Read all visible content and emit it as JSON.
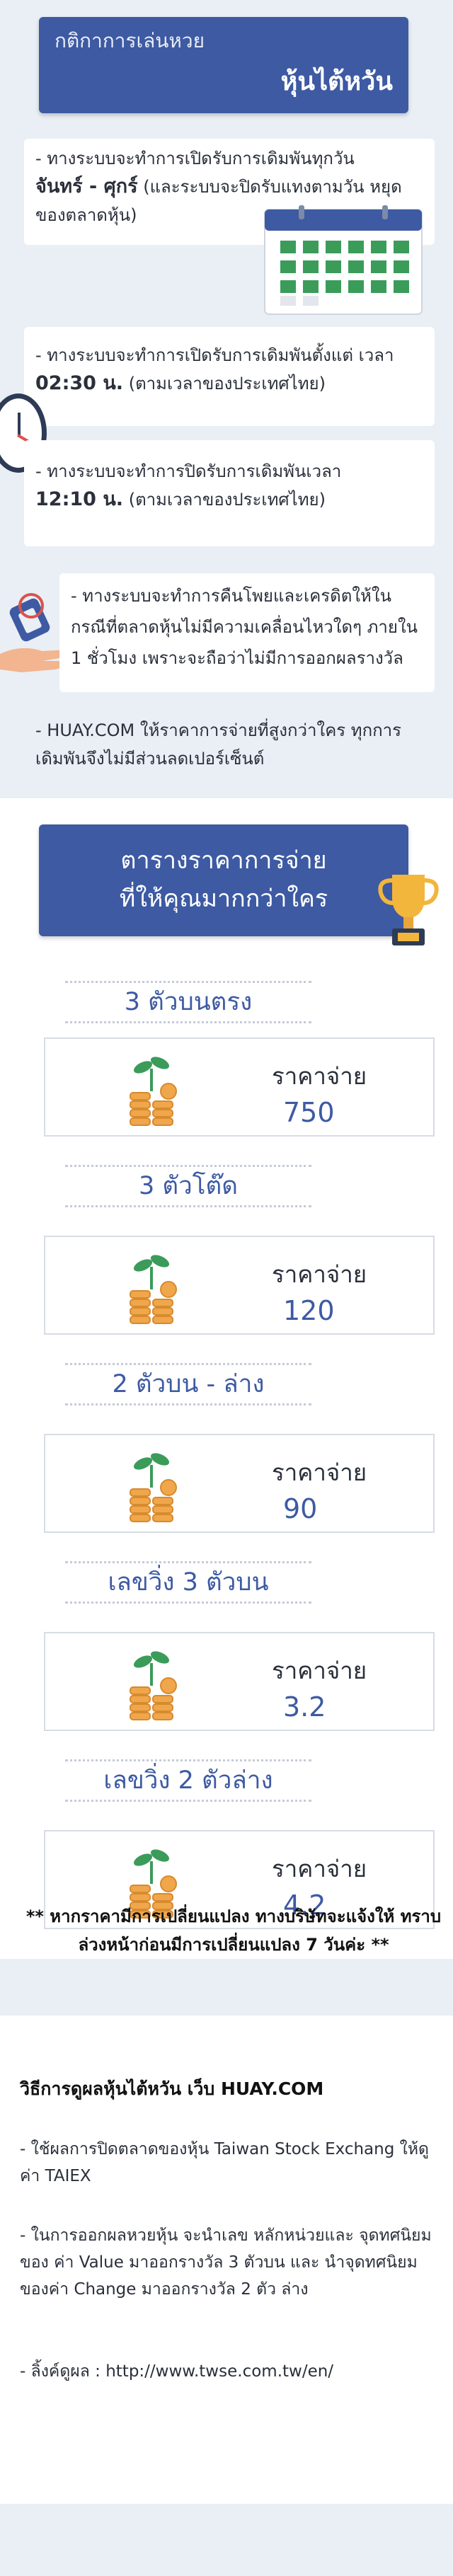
{
  "hero": {
    "subtitle": "กติกาการเล่นหวย",
    "title": "หุ้นไต้หวัน"
  },
  "rules": {
    "r1_a": "-    ทางระบบจะทำการเปิดรับการเดิมพันทุกวัน",
    "r1_b": "จันทร์ - ศุกร์",
    "r1_c": "(และระบบจะปิดรับแทงตามวัน หยุดของตลาดหุ้น)",
    "r2_a": "-    ทางระบบจะทำการเปิดรับการเดิมพันตั้งแต่ เวลา",
    "r2_b": "02:30 น.",
    "r2_c": "(ตามเวลาของประเทศไทย)",
    "r3_a": "-    ทางระบบจะทำการปิดรับการเดิมพันเวลา",
    "r3_b": "12:10 น.",
    "r3_c": "(ตามเวลาของประเทศไทย)",
    "r4": "-    ทางระบบจะทำการคืนโพยและเครดิตให้ใน กรณีที่ตลาดหุ้นไม่มีความเคลื่อนไหวใดๆ ภายใน 1 ชั่วโมง เพราะจะถือว่าไม่มีการออกผลรางวัล",
    "r5": "-    HUAY.COM ให้ราคาการจ่ายที่สูงกว่าใคร ทุกการเดิมพันจึงไม่มีส่วนลดเปอร์เซ็นต์"
  },
  "banner": {
    "line1": "ตารางราคาการจ่าย",
    "line2": "ที่ให้คุณมากกว่าใคร"
  },
  "tiers": [
    {
      "name": "3 ตัวบนตรง",
      "label": "ราคาจ่าย",
      "price": "750"
    },
    {
      "name": "3 ตัวโต๊ด",
      "label": "ราคาจ่าย",
      "price": "120"
    },
    {
      "name": "2 ตัวบน - ล่าง",
      "label": "ราคาจ่าย",
      "price": "90"
    },
    {
      "name": "เลขวิ่ง 3 ตัวบน",
      "label": "ราคาจ่าย",
      "price": "3.2"
    },
    {
      "name": "เลขวิ่ง 2 ตัวล่าง",
      "label": "ราคาจ่าย",
      "price": "4.2"
    }
  ],
  "note": "** หากราคามีการเปลี่ยนแปลง ทางบริษัทจะแจ้งให้ ทราบล่วงหน้าก่อนมีการเปลี่ยนแปลง 7 วันค่ะ **",
  "how": {
    "title": "วิธีการดูผลหุ้นไต้หวัน เว็บ HUAY.COM",
    "p1": "-    ใช้ผลการปิดตลาดของหุ้น Taiwan Stock Exchang ให้ดูค่า TAIEX",
    "p2": "-    ในการออกผลหวยหุ้น จะนำเลข หลักหน่วยและ จุดทศนิยมของ ค่า Value มาออกรางวัล 3 ตัวบน และ นำจุดทศนิยมของค่า Change มาออกรางวัล 2 ตัว ล่าง",
    "p3": "-    ลิ้งค์ดูผล : http://www.twse.com.tw/en/"
  },
  "colors": {
    "primary": "#3d5aa3",
    "calendar": "#3b9c5a",
    "accent": "#e7a53b"
  }
}
